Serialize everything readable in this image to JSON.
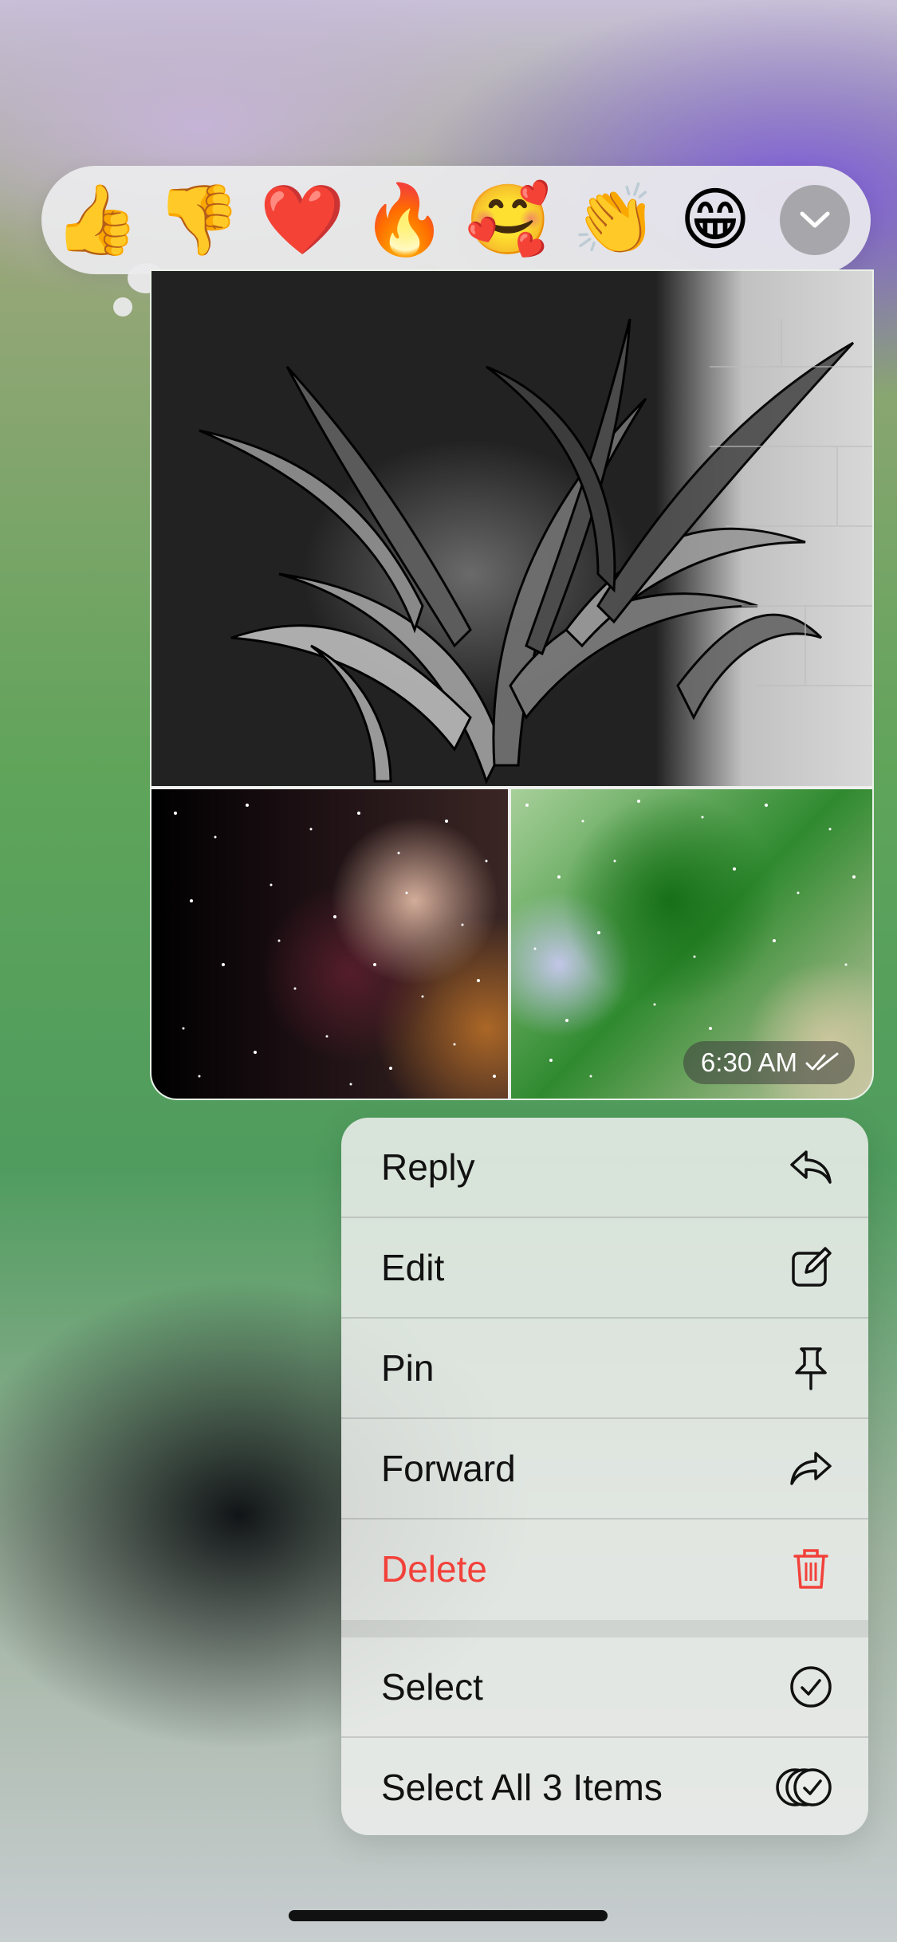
{
  "reactions": {
    "emojis": [
      {
        "name": "thumbs-up-emoji",
        "char": "👍"
      },
      {
        "name": "thumbs-down-emoji",
        "char": "👎"
      },
      {
        "name": "red-heart-emoji",
        "char": "❤️"
      },
      {
        "name": "fire-emoji",
        "char": "🔥"
      },
      {
        "name": "smiling-face-with-hearts-emoji",
        "char": "🥰"
      },
      {
        "name": "clapping-hands-emoji",
        "char": "👏"
      },
      {
        "name": "beaming-face-emoji",
        "char": "😁"
      }
    ],
    "expand_icon": "chevron-down-icon"
  },
  "message": {
    "timestamp": "6:30 AM",
    "status_icon": "double-check-icon",
    "photos": [
      "plant-photo",
      "starry-bokeh-photo",
      "green-bokeh-photo"
    ]
  },
  "menu": {
    "items": [
      {
        "label": "Reply",
        "icon": "reply-icon"
      },
      {
        "label": "Edit",
        "icon": "edit-icon"
      },
      {
        "label": "Pin",
        "icon": "pin-icon"
      },
      {
        "label": "Forward",
        "icon": "forward-icon"
      },
      {
        "label": "Delete",
        "icon": "trash-icon",
        "color": "#f2413a"
      },
      {
        "label": "Select",
        "icon": "checkmark-circle-icon"
      },
      {
        "label": "Select All 3 Items",
        "icon": "multi-select-icon"
      }
    ]
  },
  "colors": {
    "destructive": "#f2413a",
    "menu_text": "#111111"
  }
}
